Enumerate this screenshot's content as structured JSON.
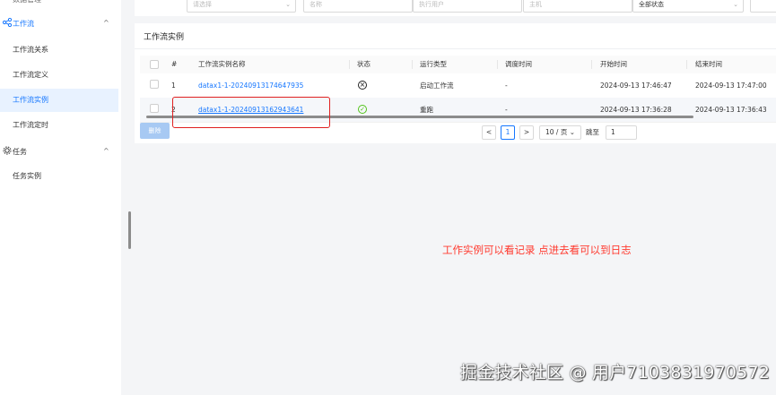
{
  "sidebar": {
    "partial_top": "数据管理",
    "workflow_group": {
      "label": "工作流",
      "icon": "share-nodes-icon",
      "chevron": "^"
    },
    "workflow_items": [
      "工作流关系",
      "工作流定义",
      "工作流实例",
      "工作流定时"
    ],
    "active_item": "工作流实例",
    "task_group": {
      "label": "任务",
      "icon": "gear-icon",
      "chevron": "^"
    },
    "task_items": [
      "任务实例"
    ]
  },
  "filters": {
    "select_placeholder": "请选择",
    "name_placeholder": "名称",
    "user_placeholder": "执行用户",
    "host_placeholder": "主机",
    "status_value": "全部状态"
  },
  "card": {
    "title": "工作流实例"
  },
  "table": {
    "headers": {
      "index": "#",
      "name": "工作流实例名称",
      "status": "状态",
      "run_type": "运行类型",
      "schedule_time": "调度时间",
      "start_time": "开始时间",
      "end_time": "结束时间"
    },
    "rows": [
      {
        "index": "1",
        "name": "datax1-1-20240913174647935",
        "status": "failed",
        "run_type": "启动工作流",
        "schedule_time": "-",
        "start_time": "2024-09-13 17:46:47",
        "end_time": "2024-09-13 17:47:00"
      },
      {
        "index": "2",
        "name": "datax1-1-20240913162943641",
        "status": "success",
        "run_type": "重跑",
        "schedule_time": "-",
        "start_time": "2024-09-13 17:36:28",
        "end_time": "2024-09-13 17:36:43"
      }
    ]
  },
  "actions": {
    "delete_label": "删除"
  },
  "pagination": {
    "prev": "<",
    "current_page": "1",
    "next": ">",
    "page_size": "10 / 页",
    "jump_label": "跳至",
    "jump_value": "1"
  },
  "annotation": {
    "text": "工作实例可以看记录 点进去看可以到日志"
  },
  "watermark": {
    "text": "掘金技术社区 @ 用户7103831970572"
  },
  "colors": {
    "accent": "#1677ff",
    "annotation": "#ff3b30",
    "success": "#52c41a"
  }
}
